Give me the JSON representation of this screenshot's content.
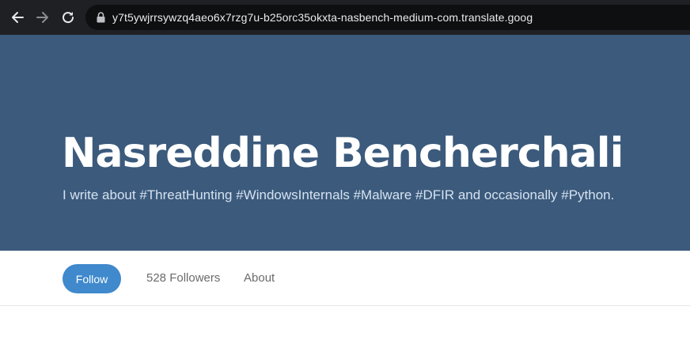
{
  "browser": {
    "url": "y7t5ywjrrsywzq4aeo6x7rzg7u-b25orc35okxta-nasbench-medium-com.translate.goog"
  },
  "profile": {
    "name": "Nasreddine Bencherchali",
    "bio": "I write about #ThreatHunting #WindowsInternals #Malware #DFIR and occasionally #Python.",
    "follow_label": "Follow",
    "followers_label": "528 Followers",
    "about_label": "About"
  },
  "colors": {
    "hero_background": "#3b5a7c",
    "follow_button": "#3f89cc",
    "browser_bar": "#1f2023"
  }
}
